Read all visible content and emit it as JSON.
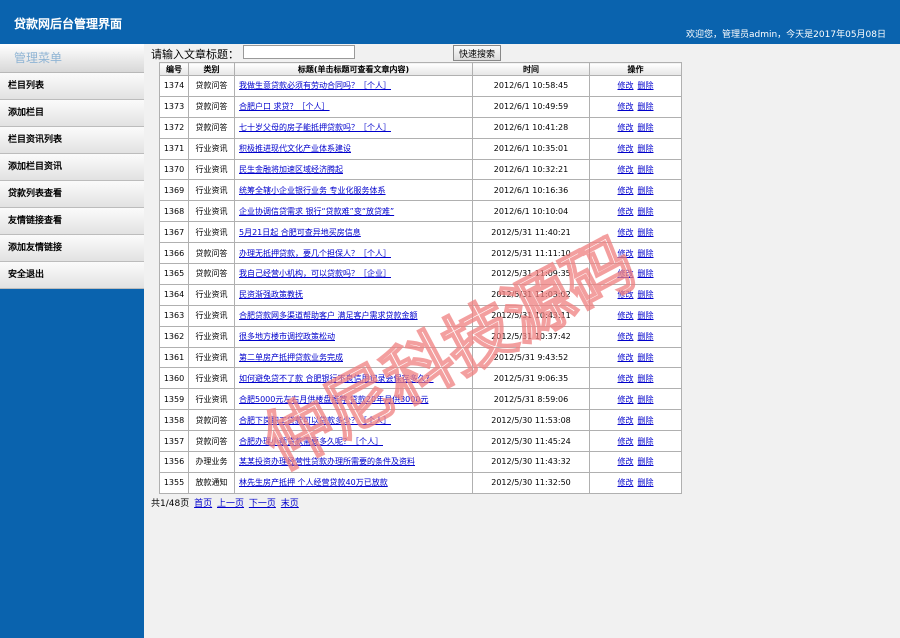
{
  "header": {
    "title": "贷款网后台管理界面",
    "welcome": "欢迎您，管理员admin，今天是2017年05月08日"
  },
  "sidebar": {
    "title": "管理菜单",
    "items": [
      "栏目列表",
      "添加栏目",
      "栏目资讯列表",
      "添加栏目资讯",
      "贷款列表查看",
      "友情链接查看",
      "添加友情链接",
      "安全退出"
    ]
  },
  "search": {
    "label": "请输入文章标题：",
    "value": "",
    "button": "快速搜索"
  },
  "table": {
    "headers": [
      "编号",
      "类别",
      "标题(单击标题可查看文章内容)",
      "时间",
      "操作"
    ],
    "edit_label": "修改",
    "delete_label": "删除",
    "rows": [
      {
        "id": "1374",
        "cat": "贷款问答",
        "title": "我做生意贷款必须有劳动合同吗？［个人］",
        "time": "2012/6/1 10:58:45"
      },
      {
        "id": "1373",
        "cat": "贷款问答",
        "title": "合肥户口 求贷？［个人］",
        "time": "2012/6/1 10:49:59"
      },
      {
        "id": "1372",
        "cat": "贷款问答",
        "title": "七十岁父母的房子能抵押贷款吗？［个人］",
        "time": "2012/6/1 10:41:28"
      },
      {
        "id": "1371",
        "cat": "行业资讯",
        "title": "积极推进现代文化产业体系建设",
        "time": "2012/6/1 10:35:01"
      },
      {
        "id": "1370",
        "cat": "行业资讯",
        "title": "民生金融将加速区域经济腾起",
        "time": "2012/6/1 10:32:21"
      },
      {
        "id": "1369",
        "cat": "行业资讯",
        "title": "统筹全辖小企业银行业务 专业化服务体系",
        "time": "2012/6/1 10:16:36"
      },
      {
        "id": "1368",
        "cat": "行业资讯",
        "title": "企业协调信贷需求 银行“贷款难”变“放贷难”",
        "time": "2012/6/1 10:10:04"
      },
      {
        "id": "1367",
        "cat": "行业资讯",
        "title": "5月21日起 合肥可查异地买房信息",
        "time": "2012/5/31 11:40:21"
      },
      {
        "id": "1366",
        "cat": "贷款问答",
        "title": "办理无抵押贷款，要几个担保人？［个人］",
        "time": "2012/5/31 11:11:10"
      },
      {
        "id": "1365",
        "cat": "贷款问答",
        "title": "我自己经营小机构，可以贷款吗？［企业］",
        "time": "2012/5/31 11:09:35"
      },
      {
        "id": "1364",
        "cat": "行业资讯",
        "title": "民资渐强政策教抚",
        "time": "2012/5/31 11:03:02"
      },
      {
        "id": "1363",
        "cat": "行业资讯",
        "title": "合肥贷款网多渠道帮助客户 满足客户需求贷款金额",
        "time": "2012/5/31 10:43:11"
      },
      {
        "id": "1362",
        "cat": "行业资讯",
        "title": "很多地方楼市调控政策松动",
        "time": "2012/5/31 10:37:42"
      },
      {
        "id": "1361",
        "cat": "行业资讯",
        "title": "第二单房产抵押贷款业务完成",
        "time": "2012/5/31 9:43:52"
      },
      {
        "id": "1360",
        "cat": "行业资讯",
        "title": "如何避免贷不了款 合肥银行不良信用记录会保存多久？",
        "time": "2012/5/31 9:06:35"
      },
      {
        "id": "1359",
        "cat": "行业资讯",
        "title": "合肥5000元左右月供楼盘推荐 贷款20年月供3000元",
        "time": "2012/5/31 8:59:06"
      },
      {
        "id": "1358",
        "cat": "贷款问答",
        "title": "合肥下岗职工贷款可以贷款多少？［个人］",
        "time": "2012/5/30 11:53:08"
      },
      {
        "id": "1357",
        "cat": "贷款问答",
        "title": "合肥办理小额贷款需要多久呢？［个人］",
        "time": "2012/5/30 11:45:24"
      },
      {
        "id": "1356",
        "cat": "办理业务",
        "title": "某某投资办理经营性贷款办理所需要的条件及资料",
        "time": "2012/5/30 11:43:32"
      },
      {
        "id": "1355",
        "cat": "放款通知",
        "title": "林先生房产抵押 个人经营贷款40万已放款",
        "time": "2012/5/30 11:32:50"
      }
    ]
  },
  "pager": {
    "info": "共1/48页",
    "first": "首页",
    "prev": "上一页",
    "next": "下一页",
    "last": "末页"
  },
  "watermark": {
    "text": "仲尼科技源码",
    "color": "#f08080"
  },
  "colors": {
    "header_bg": "#0a63ae",
    "link": "#0000cc"
  }
}
